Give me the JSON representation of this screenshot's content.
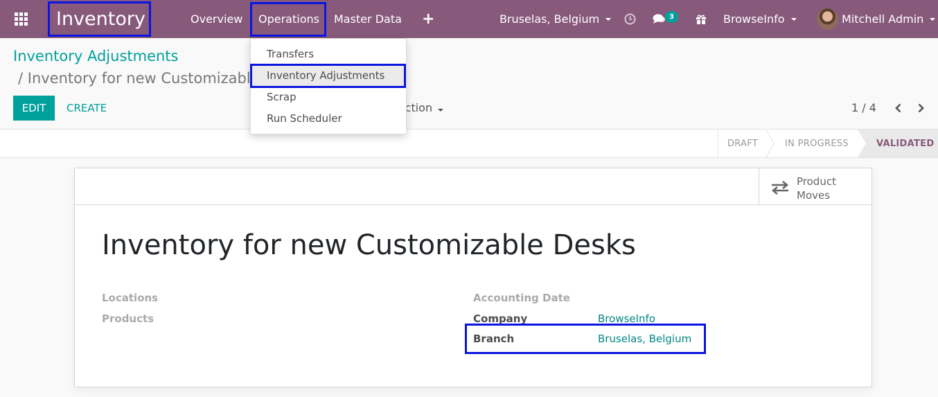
{
  "navbar": {
    "app_name": "Inventory",
    "menus": [
      "Overview",
      "Operations",
      "Master Data"
    ],
    "new_icon": "plus-icon",
    "branch_switch": "Bruselas, Belgium",
    "messages_count": "3",
    "company_switch": "BrowseInfo",
    "user_name": "Mitchell Admin",
    "colors": {
      "bar": "#875a7b",
      "highlight_box": "#0b14e0"
    }
  },
  "operations_menu": {
    "items": [
      "Transfers",
      "Inventory Adjustments",
      "Scrap",
      "Run Scheduler"
    ],
    "active_item": "Inventory Adjustments"
  },
  "breadcrumb": {
    "parent": "Inventory Adjustments",
    "current": "/ Inventory for new Customizable Desks"
  },
  "controls": {
    "edit": "EDIT",
    "create": "CREATE",
    "action": "Action",
    "pager": "1 / 4"
  },
  "status": {
    "stages": [
      "DRAFT",
      "IN PROGRESS",
      "VALIDATED"
    ],
    "current": "VALIDATED"
  },
  "form": {
    "smart_button": {
      "line1": "Product",
      "line2": "Moves",
      "icon": "transfer-arrows-icon"
    },
    "title": "Inventory for new Customizable Desks",
    "left_fields": [
      "Locations",
      "Products"
    ],
    "accounting_date_label": "Accounting Date",
    "company_label": "Company",
    "company_value": "BrowseInfo",
    "branch_label": "Branch",
    "branch_value": "Bruselas, Belgium"
  },
  "accent_color": "#00a09d"
}
